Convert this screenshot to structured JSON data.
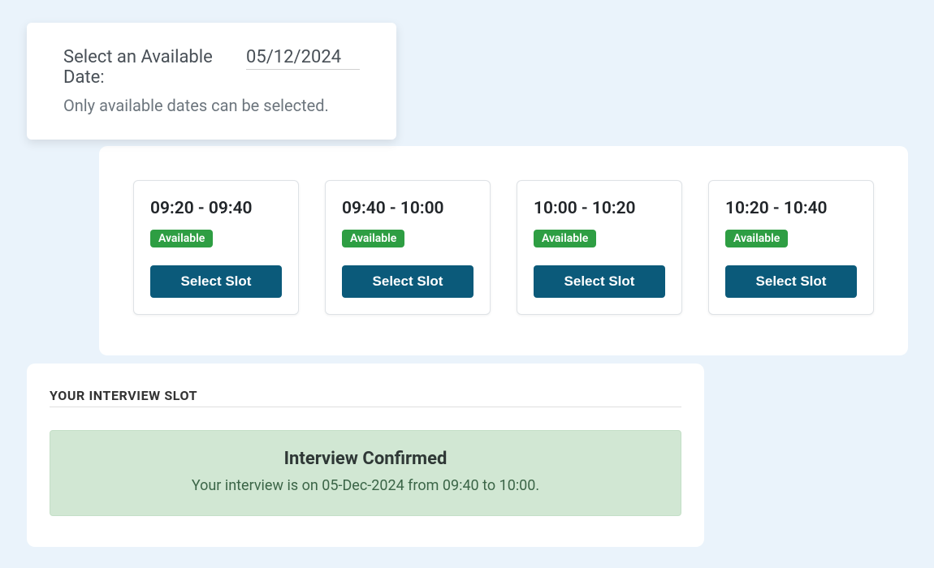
{
  "datePicker": {
    "label": "Select an Available Date:",
    "value": "05/12/2024",
    "help": "Only available dates can be selected."
  },
  "slots": [
    {
      "time": "09:20 - 09:40",
      "status": "Available",
      "button": "Select Slot"
    },
    {
      "time": "09:40 - 10:00",
      "status": "Available",
      "button": "Select Slot"
    },
    {
      "time": "10:00 - 10:20",
      "status": "Available",
      "button": "Select Slot"
    },
    {
      "time": "10:20 - 10:40",
      "status": "Available",
      "button": "Select Slot"
    }
  ],
  "confirmation": {
    "heading": "YOUR INTERVIEW SLOT",
    "title": "Interview Confirmed",
    "text": "Your interview is on 05-Dec-2024 from 09:40 to 10:00."
  },
  "colors": {
    "accent": "#0b5a7a",
    "badge": "#2e9e43",
    "successBg": "#d1e7d3"
  }
}
